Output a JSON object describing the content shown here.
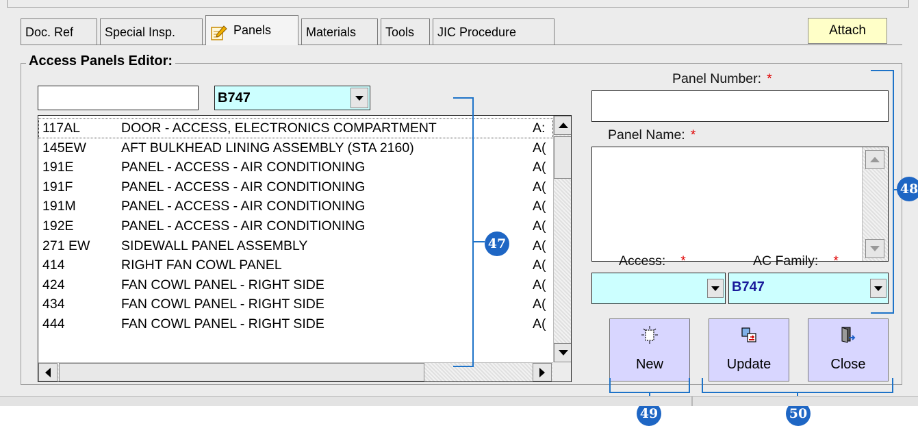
{
  "tabs": [
    {
      "label": "Doc. Ref"
    },
    {
      "label": "Special Insp."
    },
    {
      "label": "Panels",
      "icon": "notepad-pencil-icon",
      "active": true
    },
    {
      "label": "Materials"
    },
    {
      "label": "Tools"
    },
    {
      "label": "JIC Procedure"
    }
  ],
  "attach_label": "Attach",
  "editor": {
    "title": "Access Panels Editor:",
    "search_value": "",
    "family_filter": "B747"
  },
  "panel_list": [
    {
      "number": "117AL",
      "name": "DOOR - ACCESS, ELECTRONICS COMPARTMENT",
      "access": "A:"
    },
    {
      "number": "145EW",
      "name": "AFT BULKHEAD LINING ASSEMBLY (STA 2160)",
      "access": "A("
    },
    {
      "number": "191E",
      "name": "PANEL - ACCESS - AIR CONDITIONING",
      "access": "A("
    },
    {
      "number": "191F",
      "name": "PANEL - ACCESS - AIR CONDITIONING",
      "access": "A("
    },
    {
      "number": "191M",
      "name": "PANEL - ACCESS - AIR CONDITIONING",
      "access": "A("
    },
    {
      "number": "192E",
      "name": "PANEL - ACCESS - AIR CONDITIONING",
      "access": "A("
    },
    {
      "number": "271 EW",
      "name": "SIDEWALL PANEL ASSEMBLY",
      "access": "A("
    },
    {
      "number": "414",
      "name": "RIGHT FAN COWL PANEL",
      "access": "A("
    },
    {
      "number": "424",
      "name": "FAN COWL PANEL - RIGHT SIDE",
      "access": "A("
    },
    {
      "number": "434",
      "name": "FAN COWL PANEL - RIGHT SIDE",
      "access": "A("
    },
    {
      "number": "444",
      "name": "FAN COWL PANEL - RIGHT SIDE",
      "access": "A("
    }
  ],
  "form": {
    "panel_number_label": "Panel Number:",
    "panel_number_value": "",
    "panel_name_label": "Panel Name:",
    "panel_name_value": "",
    "access_label": "Access:",
    "access_value": "",
    "ac_family_label": "AC Family:",
    "ac_family_value": "B747",
    "required_mark": "*"
  },
  "buttons": {
    "new": {
      "label": "New",
      "icon": "new-document-icon"
    },
    "update": {
      "label": "Update",
      "icon": "update-icon"
    },
    "close": {
      "label": "Close",
      "icon": "exit-door-icon"
    }
  },
  "callouts": [
    "47",
    "48",
    "49",
    "50"
  ],
  "colors": {
    "combo_bg": "#ccffff",
    "attach_bg": "#ffffc8",
    "button_bg": "#d8d6ff",
    "callout": "#1e66c4",
    "required": "#e00000"
  }
}
